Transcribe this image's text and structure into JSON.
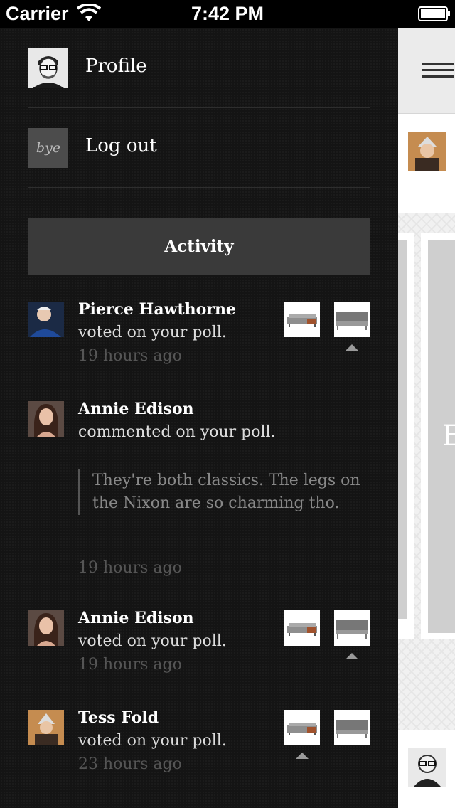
{
  "status_bar": {
    "carrier": "Carrier",
    "time": "7:42 PM"
  },
  "menu": {
    "profile_label": "Profile",
    "logout_label": "Log out",
    "logout_thumb_text": "bye"
  },
  "activity": {
    "header": "Activity",
    "items": [
      {
        "name": "Pierce Hawthorne",
        "action": "voted on your poll.",
        "time": "19 hours ago",
        "selected_option": 2
      },
      {
        "name": "Annie Edison",
        "action": "commented on your poll.",
        "quote": "They're both classics. The legs on the Nixon are so charming tho.",
        "time": "19 hours ago"
      },
      {
        "name": "Annie Edison",
        "action": "voted on your poll.",
        "time": "19 hours ago",
        "selected_option": 2
      },
      {
        "name": "Tess Fold",
        "action": "voted on your poll.",
        "time": "23 hours ago",
        "selected_option": 1
      }
    ]
  },
  "background": {
    "partial_letter": "E"
  },
  "colors": {
    "drawer_bg": "#141414",
    "activity_header_bg": "#3a3a3a",
    "timestamp": "#555555"
  }
}
